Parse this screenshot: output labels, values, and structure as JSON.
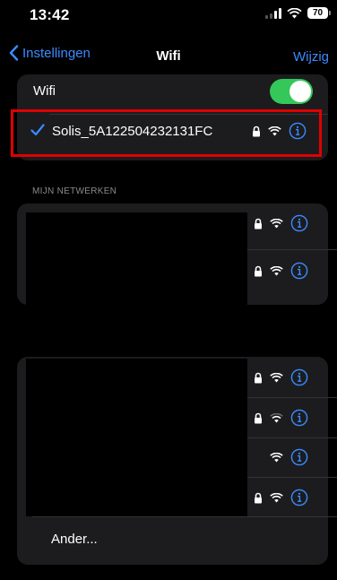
{
  "status_bar": {
    "time": "13:42",
    "battery": "70"
  },
  "nav": {
    "back_label": "Instellingen",
    "title": "Wifi",
    "edit_label": "Wijzig"
  },
  "wifi_toggle": {
    "label": "Wifi",
    "on": true
  },
  "connected_network": {
    "name": "Solis_5A122504232131FC",
    "locked": true
  },
  "my_networks": {
    "header": "MIJN NETWERKEN",
    "count": 2
  },
  "other_networks": {
    "count": 4,
    "other_label": "Ander..."
  },
  "colors": {
    "accent": "#3a8bff",
    "toggle_on": "#34c759",
    "highlight": "#e00000",
    "card": "#1c1c1e"
  }
}
